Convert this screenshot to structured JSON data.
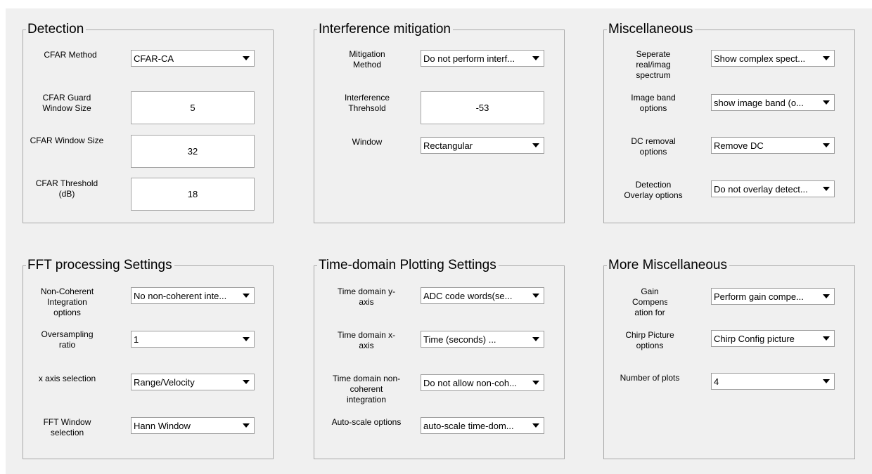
{
  "detection": {
    "title": "Detection",
    "cfar_method_label": "CFAR Method",
    "cfar_method_value": "CFAR-CA",
    "guard_label": "CFAR Guard Window Size",
    "guard_value": "5",
    "window_label": "CFAR Window Size",
    "window_value": "32",
    "threshold_label": "CFAR Threshold (dB)",
    "threshold_value": "18"
  },
  "interference": {
    "title": "Interference mitigation",
    "method_label": "Mitigation Method",
    "method_value": "Do not perform interf...",
    "threshold_label": "Interference Threhsold",
    "threshold_value": "-53",
    "window_label": "Window",
    "window_value": "Rectangular"
  },
  "misc": {
    "title": "Miscellaneous",
    "seperate_label": "Seperate real/imag spectrum",
    "seperate_value": "Show complex spect...",
    "imageband_label": "Image band options",
    "imageband_value": "show image band (o...",
    "dc_label": "DC removal options",
    "dc_value": "Remove DC",
    "overlay_label": "Detection Overlay options",
    "overlay_value": "Do not overlay detect..."
  },
  "fft": {
    "title": "FFT processing Settings",
    "noncoh_label": "Non-Coherent Integration options",
    "noncoh_value": "No non-coherent inte...",
    "oversampling_label": "Oversampling ratio",
    "oversampling_value": "1",
    "xaxis_label": "x axis selection",
    "xaxis_value": "Range/Velocity",
    "window_label": "FFT Window selection",
    "window_value": "Hann Window"
  },
  "timedomain": {
    "title": "Time-domain Plotting Settings",
    "yaxis_label": "Time domain y-axis",
    "yaxis_value": "ADC code words(se...",
    "xaxis_label": "Time domain x-axis",
    "xaxis_value": "Time (seconds)      ...",
    "noncoh_label": "Time domain non-coherent integration",
    "noncoh_value": "Do not allow non-coh...",
    "autoscale_label": "Auto-scale options",
    "autoscale_value": "auto-scale time-dom..."
  },
  "moremisc": {
    "title": "More Miscellaneous",
    "gain_label": "Gain Compens ation for",
    "gain_value": "Perform gain compe...",
    "chirp_label": "Chirp Picture options",
    "chirp_value": "Chirp Config picture",
    "nplots_label": "Number of plots",
    "nplots_value": "4"
  },
  "icons": {
    "dropdown": "chevron-down-icon"
  },
  "colors": {
    "background": "#f0f0f0",
    "panel_border": "#a9a9a9",
    "field_bg": "#ffffff"
  }
}
